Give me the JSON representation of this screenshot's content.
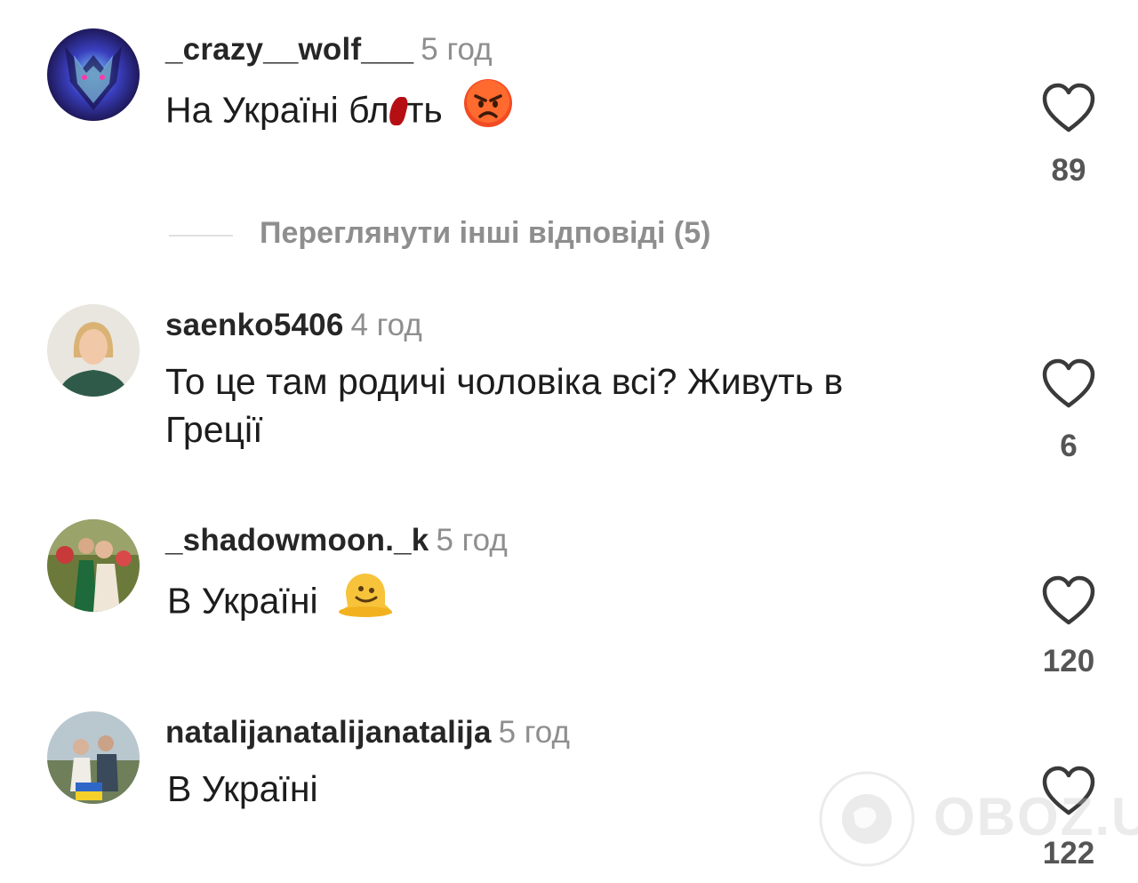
{
  "comments": [
    {
      "username": "_crazy__wolf___",
      "time": "5 год",
      "text": "На Україні бл",
      "text_end": "ть",
      "emoji": "angry-face-icon",
      "likes": "89"
    },
    {
      "username": "saenko5406",
      "time": "4 год",
      "text_line1": "То це там родичі чоловіка всі? Живуть в",
      "text_line2": "Греції",
      "likes": "6"
    },
    {
      "username": "_shadowmoon._k",
      "time": "5 год",
      "text": "В Україні",
      "emoji": "melting-face-icon",
      "likes": "120"
    },
    {
      "username": "natalijanatalijanatalija",
      "time": "5 год",
      "text": "В Україні",
      "likes": "122"
    }
  ],
  "replies_link": "Переглянути інші відповіді (5)",
  "watermark": "OBOZ.UA",
  "colors": {
    "username": "#262626",
    "muted": "#8e8e8e",
    "censor": "#b50f14"
  }
}
